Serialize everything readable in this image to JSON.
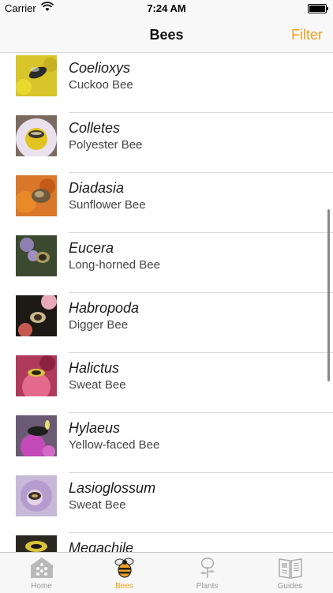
{
  "status_bar": {
    "carrier": "Carrier",
    "time": "7:24 AM"
  },
  "nav": {
    "title": "Bees",
    "filter_label": "Filter"
  },
  "bees": [
    {
      "scientific": "Coelioxys",
      "common": "Cuckoo Bee"
    },
    {
      "scientific": "Colletes",
      "common": "Polyester Bee"
    },
    {
      "scientific": "Diadasia",
      "common": "Sunflower Bee"
    },
    {
      "scientific": "Eucera",
      "common": "Long-horned Bee"
    },
    {
      "scientific": "Habropoda",
      "common": "Digger Bee"
    },
    {
      "scientific": "Halictus",
      "common": "Sweat Bee"
    },
    {
      "scientific": "Hylaeus",
      "common": "Yellow-faced Bee"
    },
    {
      "scientific": "Lasioglossum",
      "common": "Sweat Bee"
    },
    {
      "scientific": "Megachile",
      "common": ""
    }
  ],
  "tabs": [
    {
      "label": "Home",
      "icon": "home-icon"
    },
    {
      "label": "Bees",
      "icon": "bee-icon"
    },
    {
      "label": "Plants",
      "icon": "plant-icon"
    },
    {
      "label": "Guides",
      "icon": "book-icon"
    }
  ],
  "colors": {
    "accent": "#f0a020",
    "separator": "#dcdcdc",
    "inactive_tab": "#9a9a9a"
  }
}
